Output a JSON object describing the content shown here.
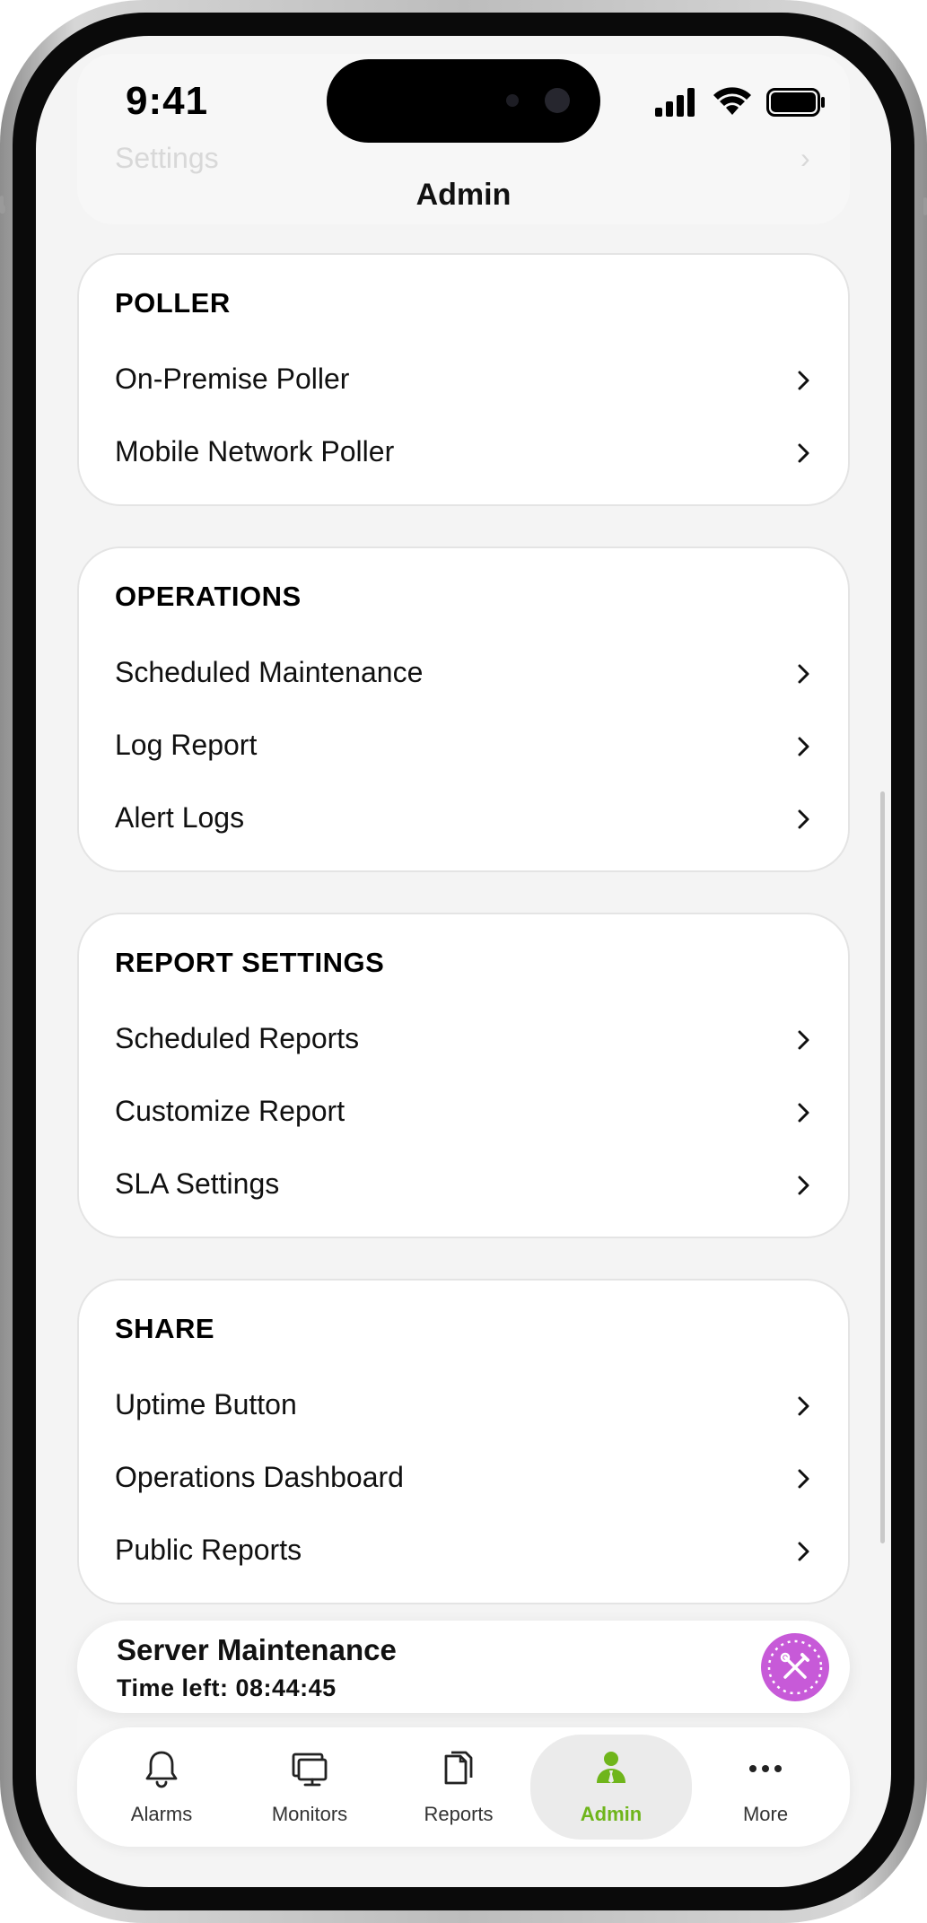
{
  "status_bar": {
    "time": "9:41"
  },
  "header": {
    "title": "Admin",
    "ghost_item_label": "Settings"
  },
  "sections": [
    {
      "heading": "POLLER",
      "items": [
        {
          "label": "On-Premise Poller"
        },
        {
          "label": "Mobile Network Poller"
        }
      ]
    },
    {
      "heading": "OPERATIONS",
      "items": [
        {
          "label": "Scheduled Maintenance"
        },
        {
          "label": "Log Report"
        },
        {
          "label": "Alert Logs"
        }
      ]
    },
    {
      "heading": "REPORT SETTINGS",
      "items": [
        {
          "label": "Scheduled Reports"
        },
        {
          "label": "Customize Report"
        },
        {
          "label": "SLA Settings"
        }
      ]
    },
    {
      "heading": "SHARE",
      "items": [
        {
          "label": "Uptime Button"
        },
        {
          "label": "Operations Dashboard"
        },
        {
          "label": "Public Reports"
        }
      ]
    }
  ],
  "maintenance_banner": {
    "title": "Server Maintenance",
    "time_left": "Time left: 08:44:45",
    "icon": "tools-icon",
    "icon_color": "#c75ad8"
  },
  "tab_bar": {
    "active_color": "#6fb51b",
    "tabs": [
      {
        "label": "Alarms",
        "icon": "bell-icon",
        "active": false
      },
      {
        "label": "Monitors",
        "icon": "monitor-icon",
        "active": false
      },
      {
        "label": "Reports",
        "icon": "reports-icon",
        "active": false
      },
      {
        "label": "Admin",
        "icon": "admin-icon",
        "active": true
      },
      {
        "label": "More",
        "icon": "more-icon",
        "active": false
      }
    ]
  }
}
